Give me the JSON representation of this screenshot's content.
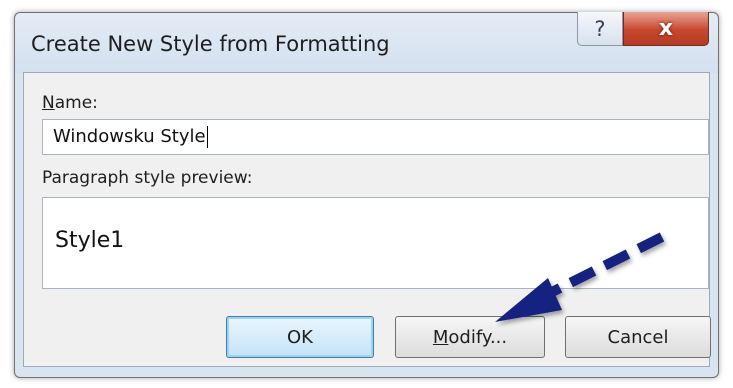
{
  "dialog": {
    "title": "Create New Style from Formatting",
    "help_icon": "help-icon",
    "close_icon": "close-icon",
    "help_glyph": "?",
    "close_glyph": "x"
  },
  "name_field": {
    "label_accel": "N",
    "label_rest": "ame:",
    "value": "Windowsku Style"
  },
  "preview": {
    "label": "Paragraph style preview:",
    "text": "Style1"
  },
  "buttons": {
    "ok": "OK",
    "modify_accel": "M",
    "modify_rest": "odify...",
    "cancel": "Cancel"
  },
  "annotation": {
    "arrow_color": "#16207f",
    "arrow_style": "dashed"
  },
  "colors": {
    "dialog_frame": "#d9e4f1",
    "close_button": "#c8472f",
    "client_area": "#f0f0f0"
  }
}
